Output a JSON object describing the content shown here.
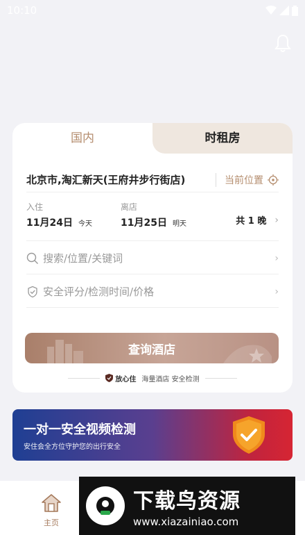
{
  "status_bar": {
    "time": "10:10"
  },
  "tabs": {
    "domestic": "国内",
    "hourly": "时租房"
  },
  "location": {
    "text": "北京市,淘汇新天(王府井步行街店)",
    "current_label": "当前位置"
  },
  "dates": {
    "checkin_label": "入住",
    "checkin_date": "11月24日",
    "checkin_day": "今天",
    "checkout_label": "离店",
    "checkout_date": "11月25日",
    "checkout_day": "明天",
    "nights": "共 1 晚"
  },
  "search": {
    "placeholder": "搜索/位置/关键词"
  },
  "filter": {
    "placeholder": "安全评分/检测时间/价格"
  },
  "query_button": {
    "label": "查询酒店"
  },
  "assurance": {
    "badge": "放心住",
    "text": "海量酒店 安全检测"
  },
  "banner": {
    "title": "一对一安全视频检测",
    "subtitle": "安住会全方位守护您的出行安全"
  },
  "bottom_nav": {
    "home": "主页"
  },
  "watermark": {
    "title": "下载鸟资源",
    "url": "www.xiazainiao.com"
  },
  "colors": {
    "accent": "#b58e6f",
    "tab_inactive_bg": "#efe7df",
    "background": "#f2f2f6"
  }
}
